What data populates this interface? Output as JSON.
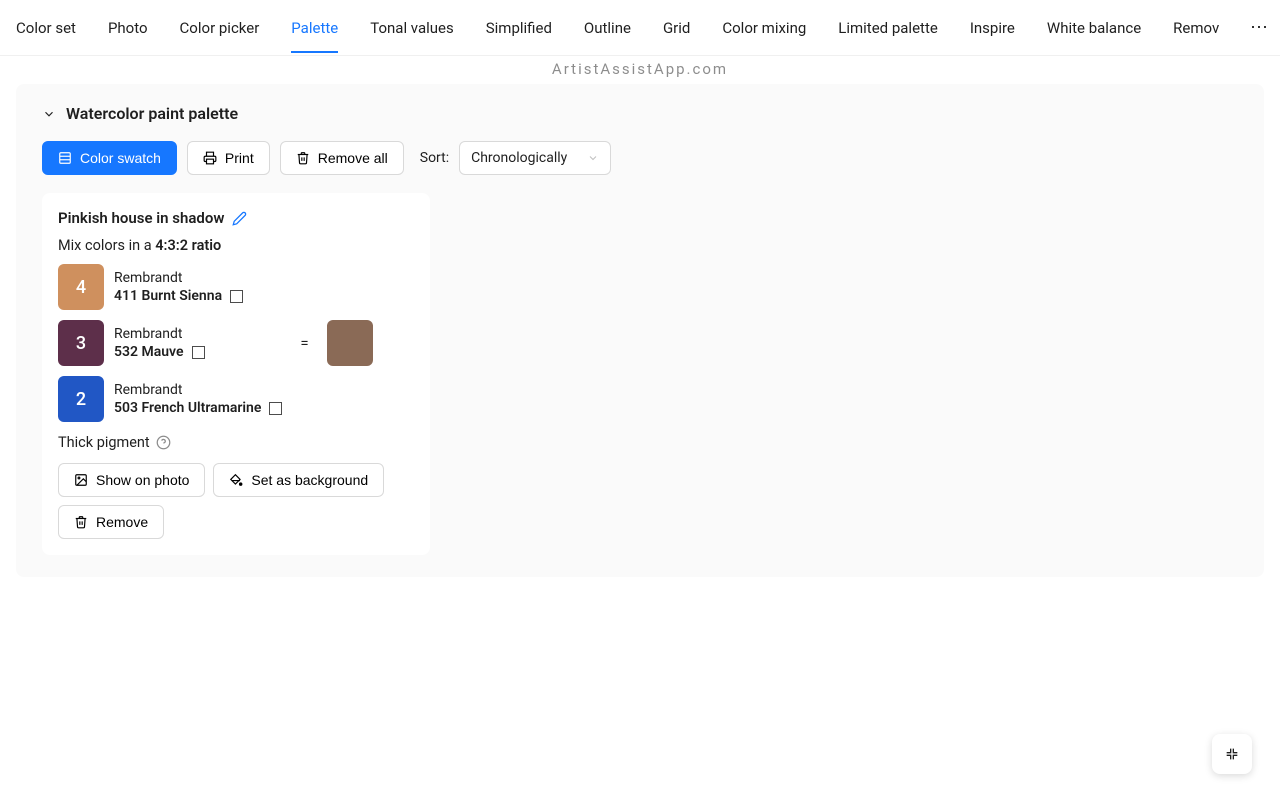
{
  "app_title": "ArtistAssistApp.com",
  "tabs": [
    {
      "label": "Color set"
    },
    {
      "label": "Photo"
    },
    {
      "label": "Color picker"
    },
    {
      "label": "Palette",
      "active": true
    },
    {
      "label": "Tonal values"
    },
    {
      "label": "Simplified"
    },
    {
      "label": "Outline"
    },
    {
      "label": "Grid"
    },
    {
      "label": "Color mixing"
    },
    {
      "label": "Limited palette"
    },
    {
      "label": "Inspire"
    },
    {
      "label": "White balance"
    },
    {
      "label": "Remov"
    }
  ],
  "panel": {
    "title": "Watercolor paint palette"
  },
  "toolbar": {
    "color_swatch": "Color swatch",
    "print": "Print",
    "remove_all": "Remove all",
    "sort_label": "Sort:",
    "sort_value": "Chronologically"
  },
  "card": {
    "title": "Pinkish house in shadow",
    "mix_prefix": "Mix colors in a ",
    "mix_ratio": "4:3:2 ratio",
    "paints": [
      {
        "parts": "4",
        "brand": "Rembrandt",
        "name": "411 Burnt Sienna",
        "color": "#cf905e"
      },
      {
        "parts": "3",
        "brand": "Rembrandt",
        "name": "532 Mauve",
        "color": "#5d2f4a"
      },
      {
        "parts": "2",
        "brand": "Rembrandt",
        "name": "503 French Ultramarine",
        "color": "#2157c5"
      }
    ],
    "equals": "=",
    "result_color": "#8a6a56",
    "thick_pigment": "Thick pigment",
    "show_on_photo": "Show on photo",
    "set_as_background": "Set as background",
    "remove": "Remove"
  }
}
